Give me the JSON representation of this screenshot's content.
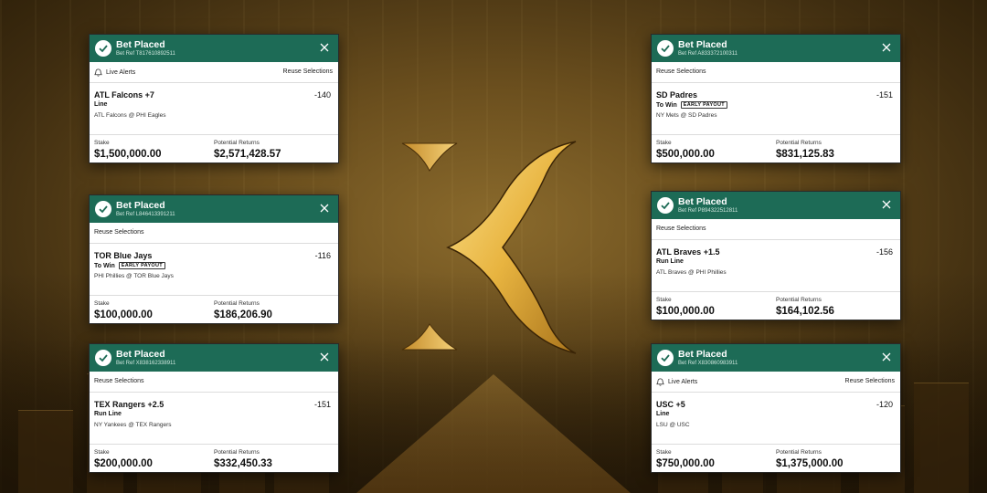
{
  "colors": {
    "header_green": "#1d6b56",
    "background_gold": "#8a6a2c",
    "logo_gold": "#e8b440"
  },
  "logo": {
    "icon": "k-logo-icon"
  },
  "cards": [
    {
      "title": "Bet Placed",
      "ref": "Bet Ref T817610892511",
      "live_alerts": "Live Alerts",
      "reuse": "Reuse Selections",
      "selection": "ATL Falcons +7",
      "odds": "-140",
      "market": "Line",
      "badge": "",
      "match": "ATL Falcons @ PHI Eagles",
      "stake_label": "Stake",
      "stake": "$1,500,000.00",
      "returns_label": "Potential Returns",
      "returns": "$2,571,428.57"
    },
    {
      "title": "Bet Placed",
      "ref": "Bet Ref A833372100311",
      "live_alerts": "",
      "reuse": "Reuse Selections",
      "selection": "SD Padres",
      "odds": "-151",
      "market": "To Win",
      "badge": "EARLY PAYOUT",
      "match": "NY Mets @ SD Padres",
      "stake_label": "Stake",
      "stake": "$500,000.00",
      "returns_label": "Potential Returns",
      "returns": "$831,125.83"
    },
    {
      "title": "Bet Placed",
      "ref": "Bet Ref L846413391211",
      "live_alerts": "",
      "reuse": "Reuse Selections",
      "selection": "TOR Blue Jays",
      "odds": "-116",
      "market": "To Win",
      "badge": "EARLY PAYOUT",
      "match": "PHI Phillies @ TOR Blue Jays",
      "stake_label": "Stake",
      "stake": "$100,000.00",
      "returns_label": "Potential Returns",
      "returns": "$186,206.90"
    },
    {
      "title": "Bet Placed",
      "ref": "Bet Ref P894322512811",
      "live_alerts": "",
      "reuse": "Reuse Selections",
      "selection": "ATL Braves +1.5",
      "odds": "-156",
      "market": "Run Line",
      "badge": "",
      "match": "ATL Braves @ PHI Phillies",
      "stake_label": "Stake",
      "stake": "$100,000.00",
      "returns_label": "Potential Returns",
      "returns": "$164,102.56"
    },
    {
      "title": "Bet Placed",
      "ref": "Bet Ref X838162338911",
      "live_alerts": "",
      "reuse": "Reuse Selections",
      "selection": "TEX Rangers +2.5",
      "odds": "-151",
      "market": "Run Line",
      "badge": "",
      "match": "NY Yankees @ TEX Rangers",
      "stake_label": "Stake",
      "stake": "$200,000.00",
      "returns_label": "Potential Returns",
      "returns": "$332,450.33"
    },
    {
      "title": "Bet Placed",
      "ref": "Bet Ref X830860983911",
      "live_alerts": "Live Alerts",
      "reuse": "Reuse Selections",
      "selection": "USC +5",
      "odds": "-120",
      "market": "Line",
      "badge": "",
      "match": "LSU @ USC",
      "stake_label": "Stake",
      "stake": "$750,000.00",
      "returns_label": "Potential Returns",
      "returns": "$1,375,000.00"
    }
  ]
}
